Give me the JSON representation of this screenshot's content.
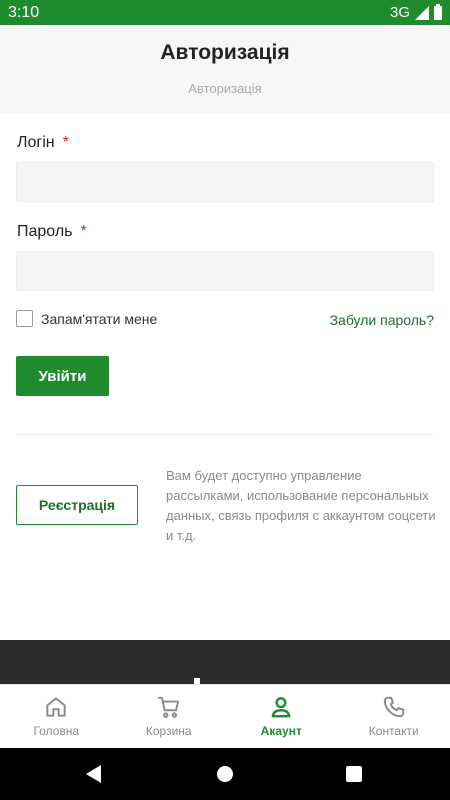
{
  "status_bar": {
    "time": "3:10",
    "network": "3G"
  },
  "header": {
    "title": "Авторизація",
    "breadcrumb": "Авторизація"
  },
  "form": {
    "login_label": "Логін",
    "password_label": "Пароль",
    "required_mark": "*",
    "login_value": "",
    "password_value": "",
    "remember_label": "Запам'ятати мене",
    "remember_checked": false,
    "forgot_link": "Забули пароль?",
    "submit_label": "Увійти"
  },
  "register": {
    "button_label": "Реєстрація",
    "note": "Вам будет доступно управление рассылками, использование персональных данных, связь профиля с аккаунтом соцсети и т.д."
  },
  "bottom_nav": {
    "items": [
      {
        "label": "Головна",
        "icon": "home-icon",
        "active": false
      },
      {
        "label": "Корзина",
        "icon": "cart-icon",
        "active": false
      },
      {
        "label": "Акаунт",
        "icon": "account-icon",
        "active": true
      },
      {
        "label": "Контакти",
        "icon": "phone-icon",
        "active": false
      }
    ]
  },
  "colors": {
    "accent": "#1f8a2e",
    "link": "#1c6f2a",
    "required": "#e02020",
    "footer": "#2b2b2b"
  }
}
